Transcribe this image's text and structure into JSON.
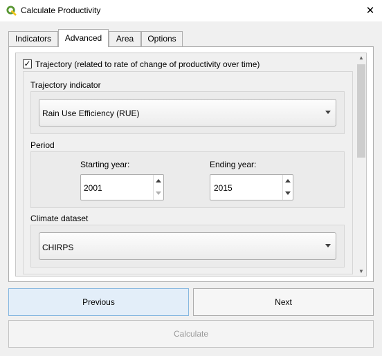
{
  "window": {
    "title": "Calculate Productivity",
    "close_glyph": "✕",
    "icon": "qgis-logo-icon"
  },
  "tabs": [
    {
      "label": "Indicators",
      "active": false
    },
    {
      "label": "Advanced",
      "active": true
    },
    {
      "label": "Area",
      "active": false
    },
    {
      "label": "Options",
      "active": false
    }
  ],
  "trajectory": {
    "checked": true,
    "check_glyph": "✓",
    "label": "Trajectory (related to rate of change of productivity over time)",
    "indicator_label": "Trajectory indicator",
    "indicator_value": "Rain Use Efficiency (RUE)",
    "period_label": "Period",
    "start_label": "Starting year:",
    "start_value": "2001",
    "end_label": "Ending year:",
    "end_value": "2015",
    "climate_label": "Climate dataset",
    "climate_value": "CHIRPS"
  },
  "buttons": {
    "previous": "Previous",
    "next": "Next",
    "calculate": "Calculate"
  },
  "colors": {
    "qgis_green": "#589632",
    "qgis_yellow": "#f0c419",
    "focus_border": "#86b7e0"
  }
}
